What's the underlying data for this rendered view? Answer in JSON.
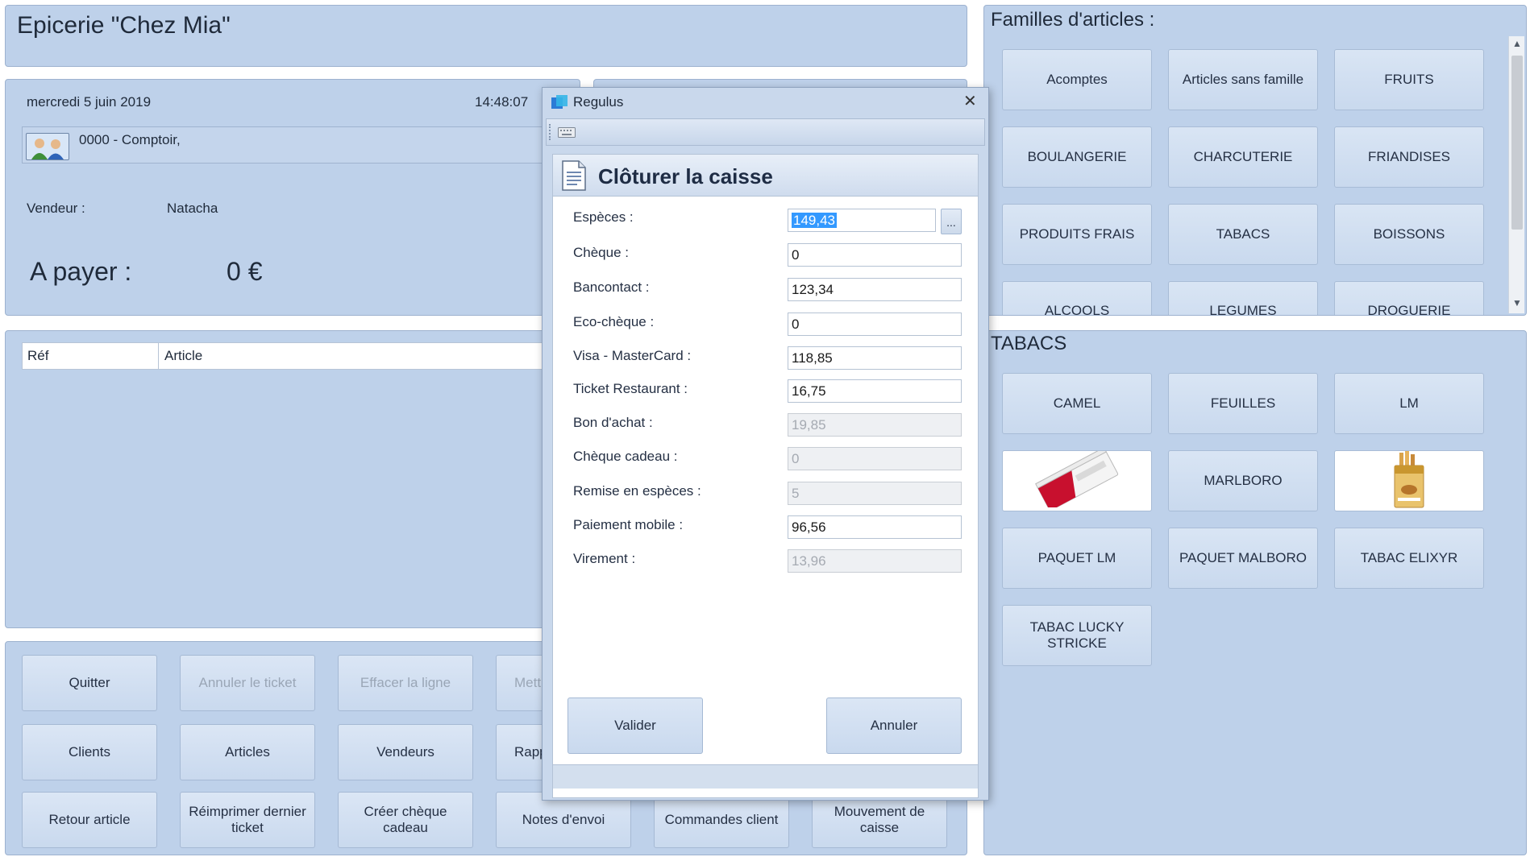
{
  "store": {
    "title": "Epicerie \"Chez Mia\""
  },
  "session": {
    "date": "mercredi 5 juin 2019",
    "time": "14:48:07",
    "customer": "0000 - Comptoir,",
    "seller_label": "Vendeur :",
    "seller_name": "Natacha",
    "amount_label": "A payer :",
    "amount_value": "0 €"
  },
  "table": {
    "columns": [
      "Réf",
      "Article"
    ]
  },
  "actions": {
    "quitter": "Quitter",
    "annuler_ticket": "Annuler le ticket",
    "effacer_ligne": "Effacer la ligne",
    "mettre": "Mettr",
    "clients": "Clients",
    "articles": "Articles",
    "vendeurs": "Vendeurs",
    "rappel": "Rapp",
    "retour_article": "Retour article",
    "reimprimer": "Réimprimer dernier ticket",
    "creer_cheque": "Créer chèque cadeau",
    "notes_envoi": "Notes d'envoi",
    "commandes_client": "Commandes client",
    "mouvement_caisse": "Mouvement de caisse"
  },
  "families": {
    "title": "Familles d'articles :",
    "items": [
      "Acomptes",
      "Articles sans famille",
      "FRUITS",
      "BOULANGERIE",
      "CHARCUTERIE",
      "FRIANDISES",
      "PRODUITS FRAIS",
      "TABACS",
      "BOISSONS",
      "ALCOOLS",
      "LEGUMES",
      "DROGUERIE"
    ]
  },
  "products": {
    "title": "TABACS",
    "items": [
      "CAMEL",
      "FEUILLES",
      "LM",
      "",
      "MARLBORO",
      "",
      "PAQUET LM",
      "PAQUET MALBORO",
      "TABAC ELIXYR",
      "TABAC LUCKY STRICKE"
    ]
  },
  "dialog": {
    "window_title": "Regulus",
    "heading": "Clôturer la caisse",
    "more_button": "...",
    "fields": [
      {
        "label": "Espèces :",
        "value": "149,43",
        "enabled": true
      },
      {
        "label": "Chèque :",
        "value": "0",
        "enabled": true
      },
      {
        "label": "Bancontact :",
        "value": "123,34",
        "enabled": true
      },
      {
        "label": "Eco-chèque :",
        "value": "0",
        "enabled": true
      },
      {
        "label": "Visa - MasterCard :",
        "value": "118,85",
        "enabled": true
      },
      {
        "label": "Ticket Restaurant :",
        "value": "16,75",
        "enabled": true
      },
      {
        "label": "Bon d'achat :",
        "value": "19,85",
        "enabled": false
      },
      {
        "label": "Chèque cadeau :",
        "value": "0",
        "enabled": false
      },
      {
        "label": "Remise en espèces :",
        "value": "5",
        "enabled": false
      },
      {
        "label": "Paiement mobile :",
        "value": "96,56",
        "enabled": true
      },
      {
        "label": "Virement :",
        "value": "13,96",
        "enabled": false
      }
    ],
    "ok_label": "Valider",
    "cancel_label": "Annuler"
  },
  "colors": {
    "panel": "#bed1ea",
    "button": "#d3e0f2",
    "selection": "#3399ff"
  }
}
